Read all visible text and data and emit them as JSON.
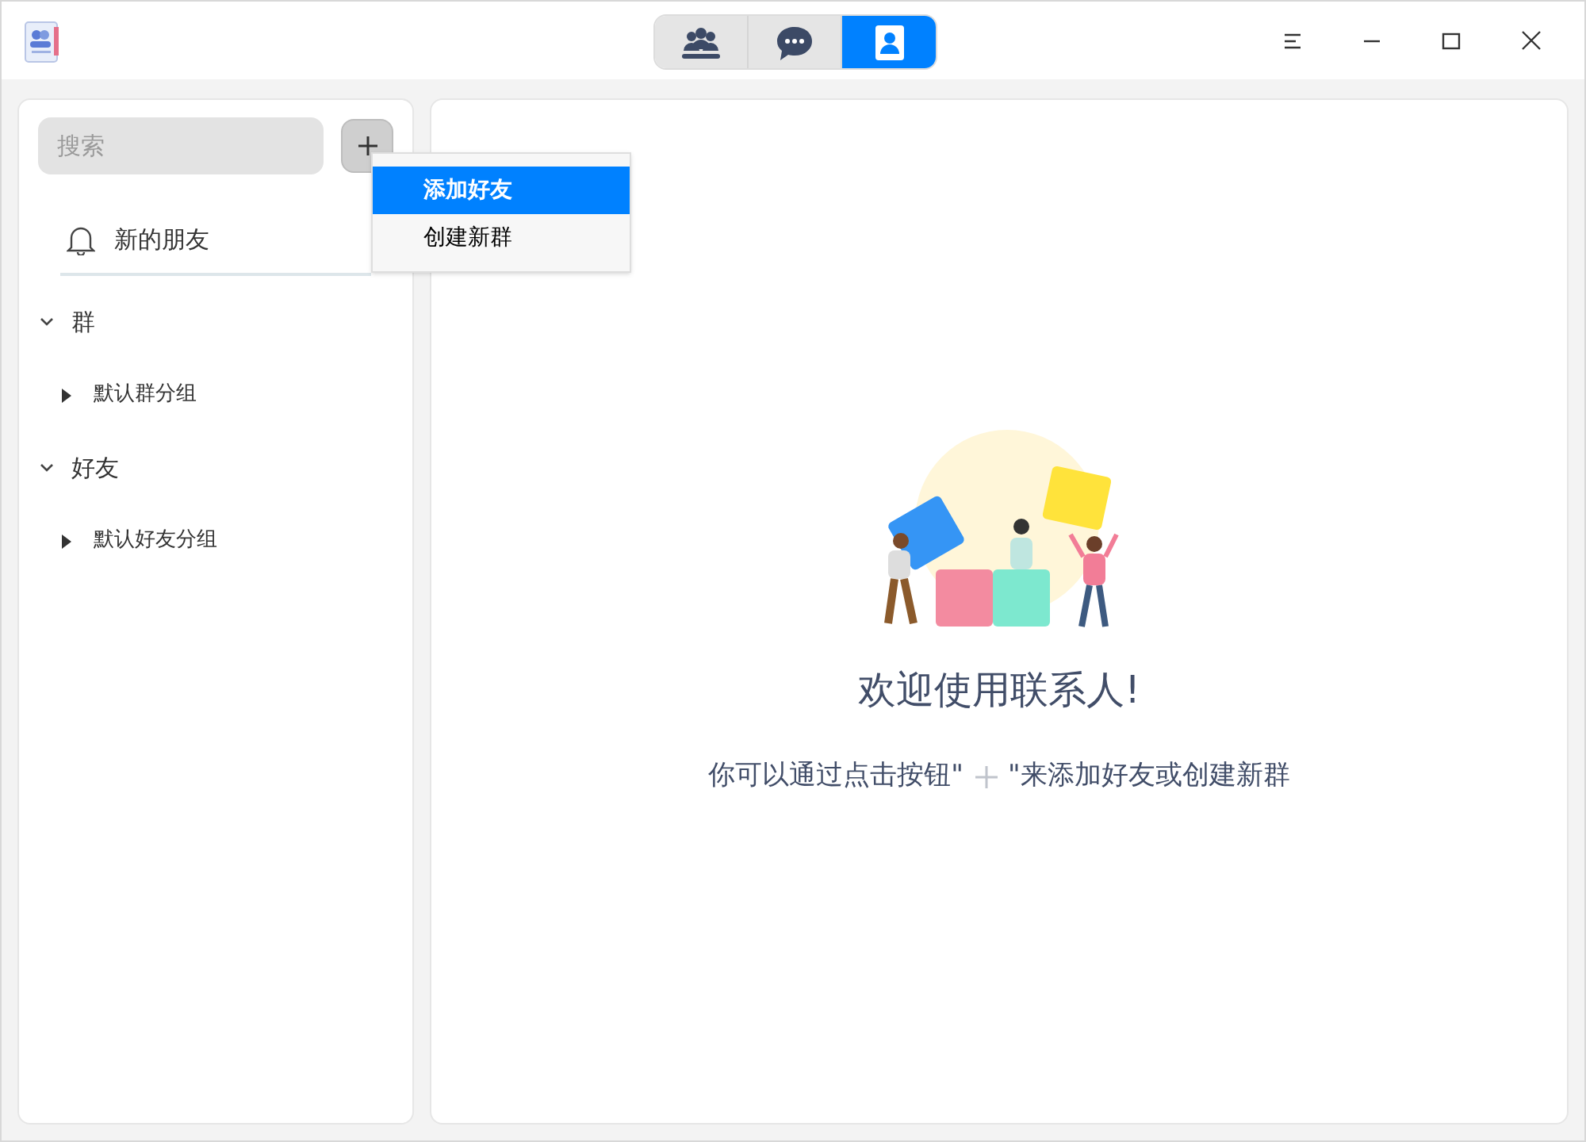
{
  "tabs": [
    {
      "kind": "groups",
      "selected": false
    },
    {
      "kind": "chat",
      "selected": false
    },
    {
      "kind": "contacts",
      "selected": true
    }
  ],
  "search": {
    "placeholder": "搜索"
  },
  "menu": [
    {
      "label": "添加好友",
      "selected": true
    },
    {
      "label": "创建新群",
      "selected": false
    }
  ],
  "new_friends": {
    "label": "新的朋友"
  },
  "tree": [
    {
      "label": "群",
      "expanded": true,
      "children": [
        {
          "label": "默认群分组",
          "expanded": false
        }
      ]
    },
    {
      "label": "好友",
      "expanded": true,
      "children": [
        {
          "label": "默认好友分组",
          "expanded": false
        }
      ]
    }
  ],
  "welcome": {
    "title": "欢迎使用联系人!",
    "hint_before": "你可以通过点击按钮\"",
    "hint_after": "\"来添加好友或创建新群"
  }
}
